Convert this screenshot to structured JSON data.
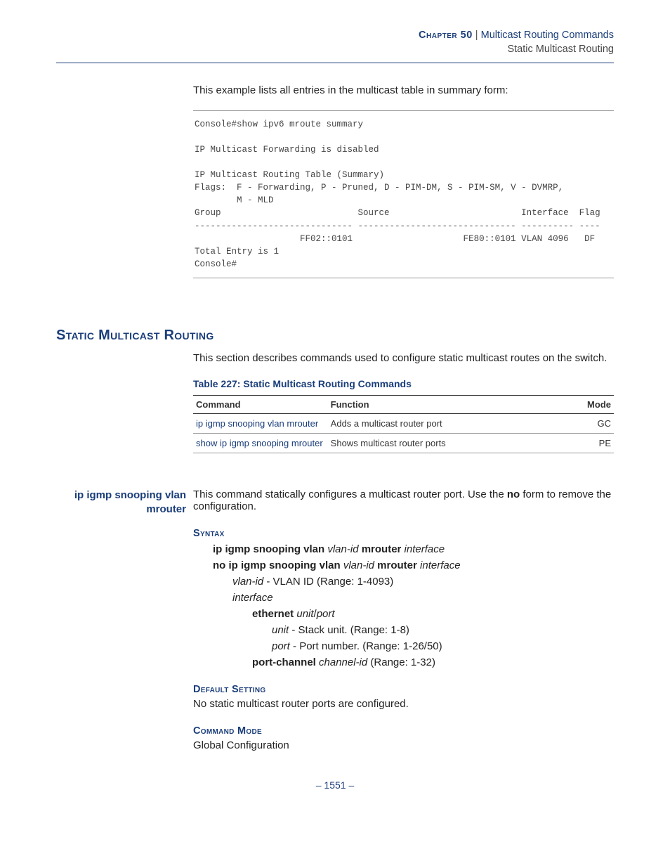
{
  "header": {
    "chapter_label": "Chapter 50",
    "separator": "  |  ",
    "title": "Multicast Routing Commands",
    "subtitle": "Static Multicast Routing"
  },
  "intro": "This example lists all entries in the multicast table in summary form:",
  "codeblock": "Console#show ipv6 mroute summary\n\nIP Multicast Forwarding is disabled\n\nIP Multicast Routing Table (Summary)\nFlags:  F - Forwarding, P - Pruned, D - PIM-DM, S - PIM-SM, V - DVMRP,\n        M - MLD\nGroup                          Source                         Interface  Flag\n------------------------------ ------------------------------ ---------- ----\n                    FF02::0101                     FE80::0101 VLAN 4096   DF\nTotal Entry is 1\nConsole#",
  "section": {
    "heading": "Static Multicast Routing",
    "desc": "This section describes commands used to configure static multicast routes on the switch.",
    "table_caption": "Table 227: Static Multicast Routing Commands",
    "table": {
      "headers": {
        "command": "Command",
        "function": "Function",
        "mode": "Mode"
      },
      "rows": [
        {
          "command": "ip igmp snooping vlan mrouter",
          "function": "Adds a multicast router port",
          "mode": "GC"
        },
        {
          "command": "show ip igmp snooping mrouter",
          "function": "Shows multicast router ports",
          "mode": "PE"
        }
      ]
    }
  },
  "command": {
    "side_name": "ip igmp snooping vlan mrouter",
    "desc_pre": "This command statically configures a multicast router port. Use the ",
    "desc_bold": "no",
    "desc_post": " form to remove the configuration.",
    "syntax_label": "Syntax",
    "syntax": {
      "l1_b1": "ip igmp snooping vlan ",
      "l1_i1": "vlan-id",
      "l1_b2": " mrouter ",
      "l1_i2": "interface",
      "l2_b1": "no ip igmp snooping vlan ",
      "l2_i1": "vlan-id",
      "l2_b2": " mrouter ",
      "l2_i2": "interface",
      "vlan_i": "vlan-id",
      "vlan_t": " - VLAN ID (Range: 1-4093)",
      "iface_i": "interface",
      "eth_b": "ethernet ",
      "eth_i1": "unit",
      "eth_sep": "/",
      "eth_i2": "port",
      "unit_i": "unit",
      "unit_t": " - Stack unit. (Range: 1-8)",
      "port_i": "port",
      "port_t": " - Port number. (Range: 1-26/50)",
      "pc_b": "port-channel ",
      "pc_i": "channel-id",
      "pc_t": " (Range: 1-32)"
    },
    "default_label": "Default Setting",
    "default_text": "No static multicast router ports are configured.",
    "mode_label": "Command Mode",
    "mode_text": "Global Configuration"
  },
  "page_number": "–  1551  –"
}
